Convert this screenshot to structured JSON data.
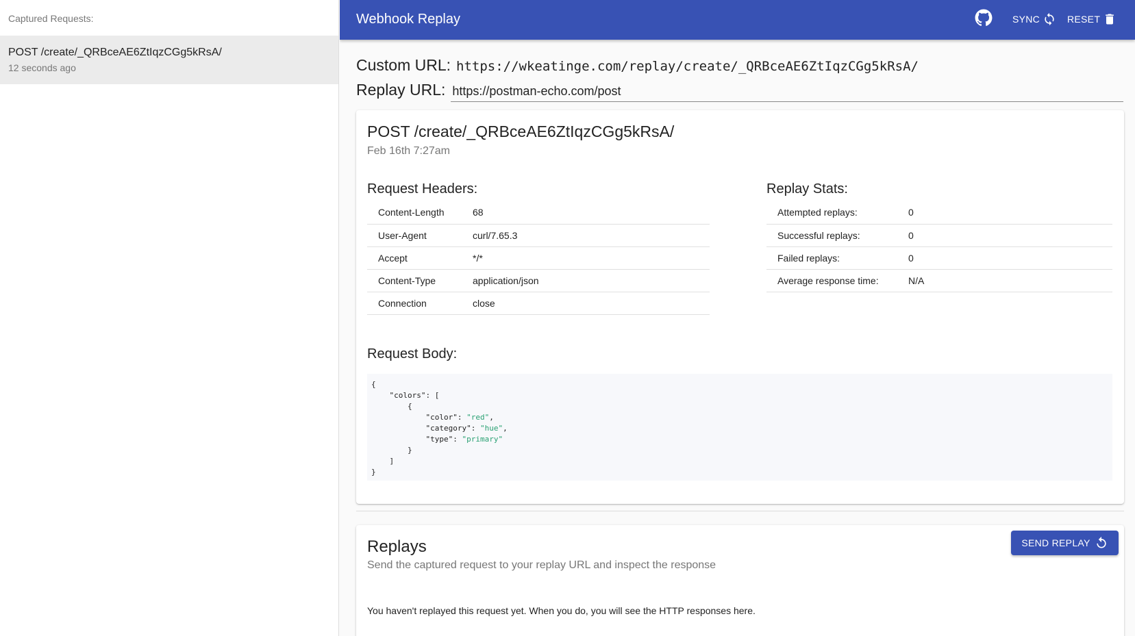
{
  "sidebar": {
    "header": "Captured Requests:",
    "items": [
      {
        "path": "POST /create/_QRBceAE6ZtIqzCGg5kRsA/",
        "time": "12 seconds ago"
      }
    ]
  },
  "appbar": {
    "title": "Webhook Replay",
    "github_icon": "github-icon",
    "sync_label": "SYNC",
    "sync_icon": "sync-icon",
    "reset_label": "RESET",
    "reset_icon": "trash-icon",
    "color": "#3852b4"
  },
  "urls": {
    "custom_label": "Custom URL:",
    "custom_value": "https://wkeatinge.com/replay/create/_QRBceAE6ZtIqzCGg5kRsA/",
    "replay_label": "Replay URL:",
    "replay_value": "https://postman-echo.com/post"
  },
  "request": {
    "title": "POST /create/_QRBceAE6ZtIqzCGg5kRsA/",
    "date": "Feb 16th 7:27am",
    "headers_title": "Request Headers:",
    "headers": [
      {
        "name": "Content-Length",
        "value": "68"
      },
      {
        "name": "User-Agent",
        "value": "curl/7.65.3"
      },
      {
        "name": "Accept",
        "value": "*/*"
      },
      {
        "name": "Content-Type",
        "value": "application/json"
      },
      {
        "name": "Connection",
        "value": "close"
      }
    ],
    "stats_title": "Replay Stats:",
    "stats": [
      {
        "name": "Attempted replays:",
        "value": "0"
      },
      {
        "name": "Successful replays:",
        "value": "0"
      },
      {
        "name": "Failed replays:",
        "value": "0"
      },
      {
        "name": "Average response time:",
        "value": "N/A"
      }
    ],
    "body_title": "Request Body:",
    "body": {
      "line1": "{",
      "line2_key": "\"colors\"",
      "line2_rest": ": [",
      "line3": "{",
      "color_key": "\"color\"",
      "color_val": "\"red\"",
      "category_key": "\"category\"",
      "category_val": "\"hue\"",
      "type_key": "\"type\"",
      "type_val": "\"primary\"",
      "close_obj": "}",
      "close_arr": "]",
      "close_root": "}"
    }
  },
  "replays": {
    "title": "Replays",
    "subtitle": "Send the captured request to your replay URL and inspect the response",
    "send_label": "SEND REPLAY",
    "send_icon": "replay-icon",
    "empty_text": "You haven't replayed this request yet. When you do, you will see the HTTP responses here."
  }
}
